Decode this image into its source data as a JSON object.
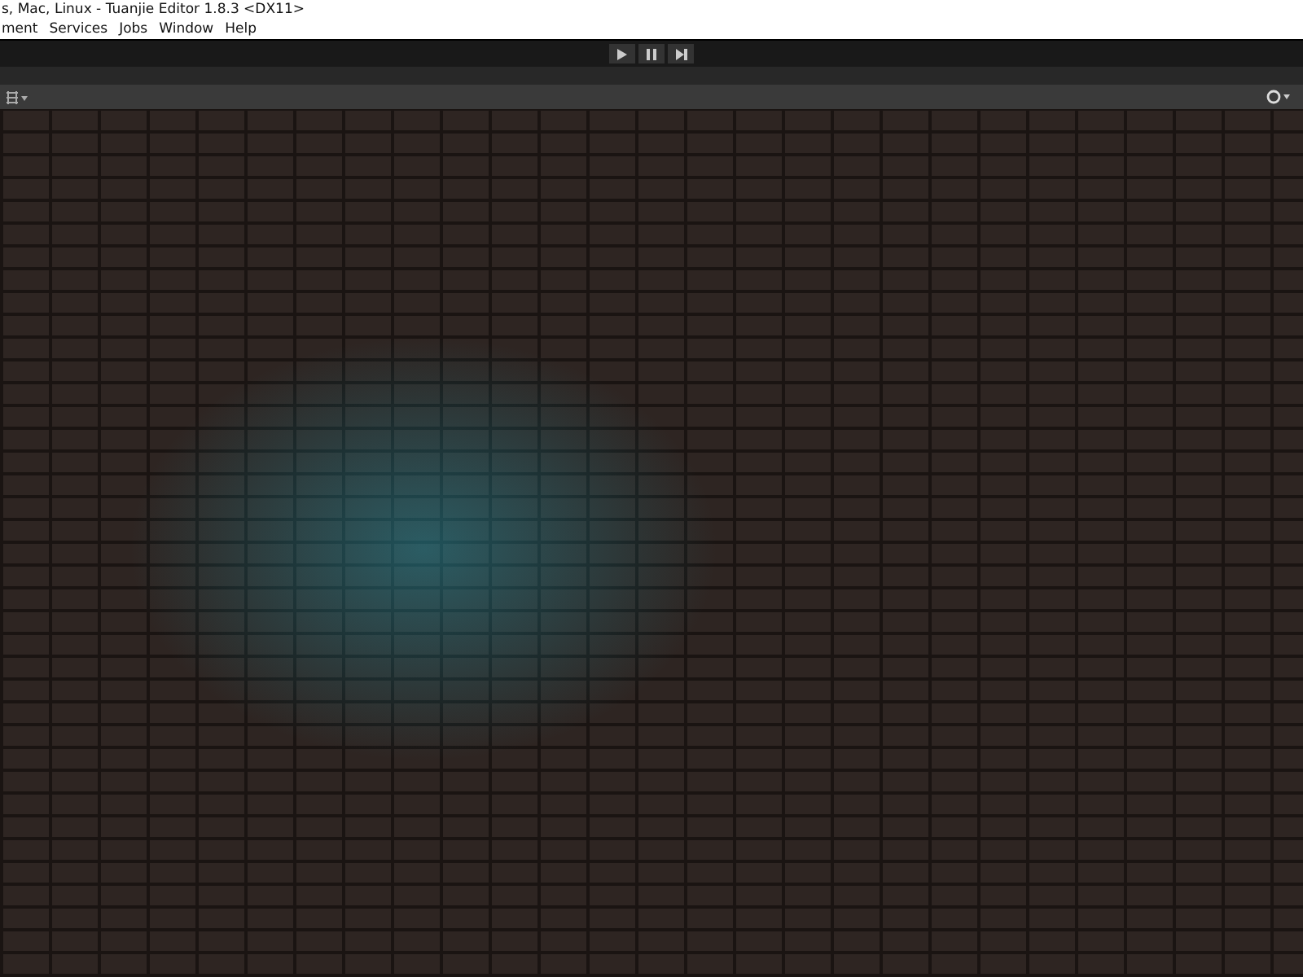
{
  "window": {
    "title": "s, Mac, Linux - Tuanjie Editor 1.8.3 <DX11>"
  },
  "menu_bar": {
    "items": [
      "ment",
      "Services",
      "Jobs",
      "Window",
      "Help"
    ]
  }
}
